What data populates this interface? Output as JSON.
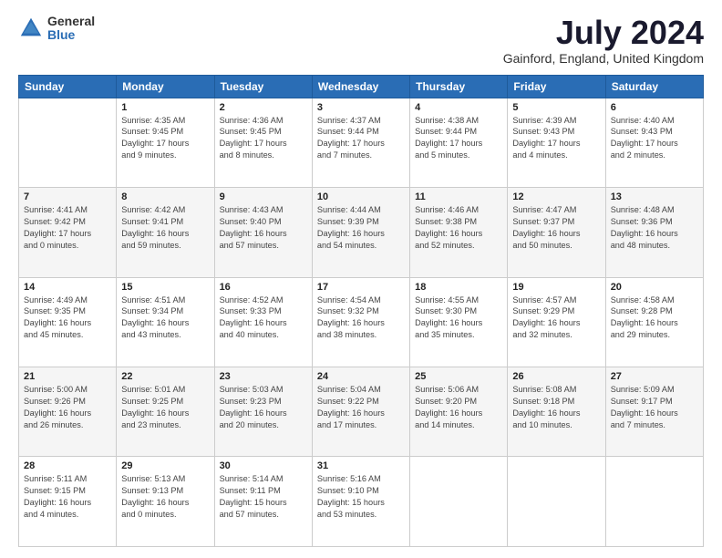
{
  "header": {
    "logo_general": "General",
    "logo_blue": "Blue",
    "main_title": "July 2024",
    "subtitle": "Gainford, England, United Kingdom"
  },
  "calendar": {
    "headers": [
      "Sunday",
      "Monday",
      "Tuesday",
      "Wednesday",
      "Thursday",
      "Friday",
      "Saturday"
    ],
    "weeks": [
      [
        {
          "day": "",
          "info": ""
        },
        {
          "day": "1",
          "info": "Sunrise: 4:35 AM\nSunset: 9:45 PM\nDaylight: 17 hours\nand 9 minutes."
        },
        {
          "day": "2",
          "info": "Sunrise: 4:36 AM\nSunset: 9:45 PM\nDaylight: 17 hours\nand 8 minutes."
        },
        {
          "day": "3",
          "info": "Sunrise: 4:37 AM\nSunset: 9:44 PM\nDaylight: 17 hours\nand 7 minutes."
        },
        {
          "day": "4",
          "info": "Sunrise: 4:38 AM\nSunset: 9:44 PM\nDaylight: 17 hours\nand 5 minutes."
        },
        {
          "day": "5",
          "info": "Sunrise: 4:39 AM\nSunset: 9:43 PM\nDaylight: 17 hours\nand 4 minutes."
        },
        {
          "day": "6",
          "info": "Sunrise: 4:40 AM\nSunset: 9:43 PM\nDaylight: 17 hours\nand 2 minutes."
        }
      ],
      [
        {
          "day": "7",
          "info": "Sunrise: 4:41 AM\nSunset: 9:42 PM\nDaylight: 17 hours\nand 0 minutes."
        },
        {
          "day": "8",
          "info": "Sunrise: 4:42 AM\nSunset: 9:41 PM\nDaylight: 16 hours\nand 59 minutes."
        },
        {
          "day": "9",
          "info": "Sunrise: 4:43 AM\nSunset: 9:40 PM\nDaylight: 16 hours\nand 57 minutes."
        },
        {
          "day": "10",
          "info": "Sunrise: 4:44 AM\nSunset: 9:39 PM\nDaylight: 16 hours\nand 54 minutes."
        },
        {
          "day": "11",
          "info": "Sunrise: 4:46 AM\nSunset: 9:38 PM\nDaylight: 16 hours\nand 52 minutes."
        },
        {
          "day": "12",
          "info": "Sunrise: 4:47 AM\nSunset: 9:37 PM\nDaylight: 16 hours\nand 50 minutes."
        },
        {
          "day": "13",
          "info": "Sunrise: 4:48 AM\nSunset: 9:36 PM\nDaylight: 16 hours\nand 48 minutes."
        }
      ],
      [
        {
          "day": "14",
          "info": "Sunrise: 4:49 AM\nSunset: 9:35 PM\nDaylight: 16 hours\nand 45 minutes."
        },
        {
          "day": "15",
          "info": "Sunrise: 4:51 AM\nSunset: 9:34 PM\nDaylight: 16 hours\nand 43 minutes."
        },
        {
          "day": "16",
          "info": "Sunrise: 4:52 AM\nSunset: 9:33 PM\nDaylight: 16 hours\nand 40 minutes."
        },
        {
          "day": "17",
          "info": "Sunrise: 4:54 AM\nSunset: 9:32 PM\nDaylight: 16 hours\nand 38 minutes."
        },
        {
          "day": "18",
          "info": "Sunrise: 4:55 AM\nSunset: 9:30 PM\nDaylight: 16 hours\nand 35 minutes."
        },
        {
          "day": "19",
          "info": "Sunrise: 4:57 AM\nSunset: 9:29 PM\nDaylight: 16 hours\nand 32 minutes."
        },
        {
          "day": "20",
          "info": "Sunrise: 4:58 AM\nSunset: 9:28 PM\nDaylight: 16 hours\nand 29 minutes."
        }
      ],
      [
        {
          "day": "21",
          "info": "Sunrise: 5:00 AM\nSunset: 9:26 PM\nDaylight: 16 hours\nand 26 minutes."
        },
        {
          "day": "22",
          "info": "Sunrise: 5:01 AM\nSunset: 9:25 PM\nDaylight: 16 hours\nand 23 minutes."
        },
        {
          "day": "23",
          "info": "Sunrise: 5:03 AM\nSunset: 9:23 PM\nDaylight: 16 hours\nand 20 minutes."
        },
        {
          "day": "24",
          "info": "Sunrise: 5:04 AM\nSunset: 9:22 PM\nDaylight: 16 hours\nand 17 minutes."
        },
        {
          "day": "25",
          "info": "Sunrise: 5:06 AM\nSunset: 9:20 PM\nDaylight: 16 hours\nand 14 minutes."
        },
        {
          "day": "26",
          "info": "Sunrise: 5:08 AM\nSunset: 9:18 PM\nDaylight: 16 hours\nand 10 minutes."
        },
        {
          "day": "27",
          "info": "Sunrise: 5:09 AM\nSunset: 9:17 PM\nDaylight: 16 hours\nand 7 minutes."
        }
      ],
      [
        {
          "day": "28",
          "info": "Sunrise: 5:11 AM\nSunset: 9:15 PM\nDaylight: 16 hours\nand 4 minutes."
        },
        {
          "day": "29",
          "info": "Sunrise: 5:13 AM\nSunset: 9:13 PM\nDaylight: 16 hours\nand 0 minutes."
        },
        {
          "day": "30",
          "info": "Sunrise: 5:14 AM\nSunset: 9:11 PM\nDaylight: 15 hours\nand 57 minutes."
        },
        {
          "day": "31",
          "info": "Sunrise: 5:16 AM\nSunset: 9:10 PM\nDaylight: 15 hours\nand 53 minutes."
        },
        {
          "day": "",
          "info": ""
        },
        {
          "day": "",
          "info": ""
        },
        {
          "day": "",
          "info": ""
        }
      ]
    ]
  }
}
